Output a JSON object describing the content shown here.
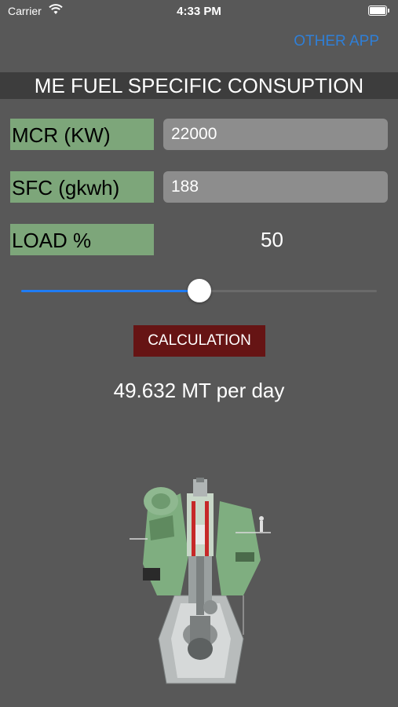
{
  "status_bar": {
    "carrier": "Carrier",
    "time": "4:33 PM"
  },
  "nav": {
    "other_app": "OTHER APP"
  },
  "title": "ME FUEL SPECIFIC CONSUPTION",
  "mcr": {
    "label": "MCR (KW)",
    "value": "22000"
  },
  "sfc": {
    "label": "SFC (gkwh)",
    "value": "188"
  },
  "load": {
    "label": "LOAD %",
    "value": "50",
    "slider_fraction": 0.5
  },
  "calculate_button": "CALCULATION",
  "result": "49.632 MT per day",
  "colors": {
    "accent": "#2f7fd7",
    "slider": "#1f7cf5",
    "label_bg": "#7da67a",
    "button_bg": "#661414"
  }
}
